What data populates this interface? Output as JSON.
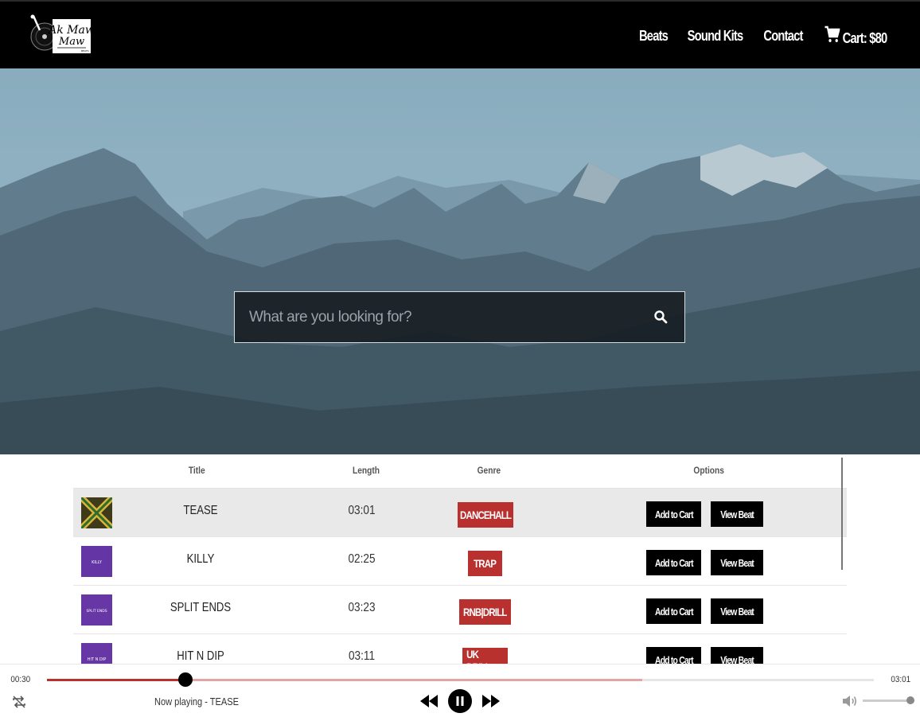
{
  "header": {
    "logo_text": "Ak Maw",
    "logo_sub": "BEATS",
    "nav": [
      {
        "label": "Beats"
      },
      {
        "label": "Sound Kits"
      },
      {
        "label": "Contact"
      }
    ],
    "cart_label": "Cart: $80"
  },
  "search": {
    "placeholder": "What are you looking for?"
  },
  "table": {
    "columns": {
      "title": "Title",
      "length": "Length",
      "genre": "Genre",
      "options": "Options"
    },
    "rows": [
      {
        "title": "TEASE",
        "length": "03:01",
        "genre": "DANCEHALL",
        "add_label": "Add to Cart",
        "view_label": "View Beat",
        "thumb_text": ""
      },
      {
        "title": "KILLY",
        "length": "02:25",
        "genre": "TRAP",
        "add_label": "Add to Cart",
        "view_label": "View Beat",
        "thumb_text": "KILLY"
      },
      {
        "title": "SPLIT ENDS",
        "length": "03:23",
        "genre": "RNB|DRILL",
        "add_label": "Add to Cart",
        "view_label": "View Beat",
        "thumb_text": "SPLIT ENDS"
      },
      {
        "title": "HIT N DIP",
        "length": "03:11",
        "genre": "UK DRILL",
        "add_label": "Add to Cart",
        "view_label": "View Beat",
        "thumb_text": "HIT N DIP"
      }
    ]
  },
  "player": {
    "current_time": "00:30",
    "duration": "03:01",
    "now_playing": "Now playing - TEASE",
    "progress_fraction": 0.167,
    "buffered_fraction": 0.72,
    "volume_fraction": 1.0
  },
  "colors": {
    "accent": "#b8312f",
    "header_bg": "#000000",
    "button_bg": "#000000"
  }
}
